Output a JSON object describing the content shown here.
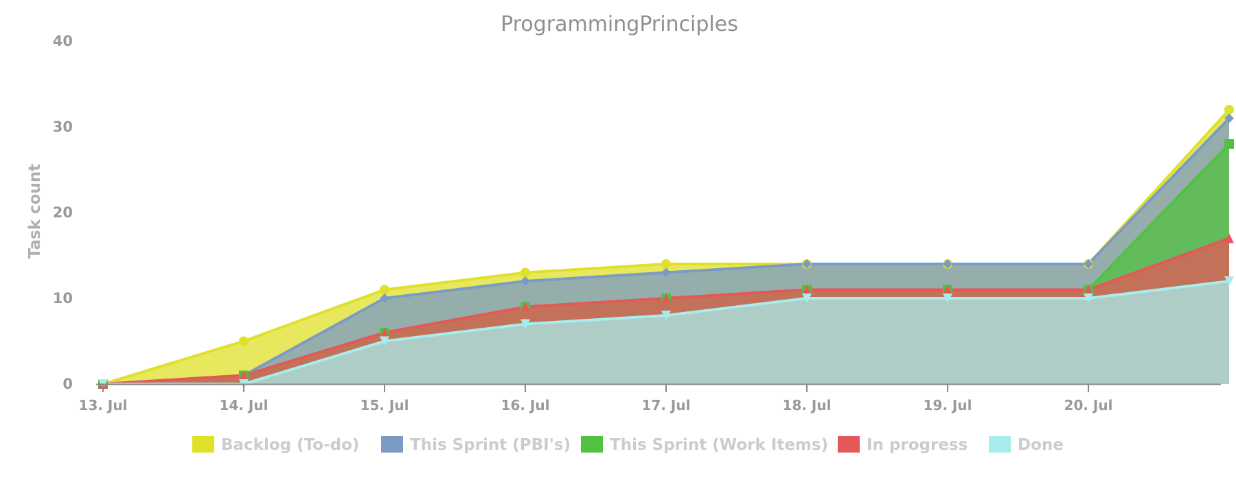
{
  "chart_data": {
    "type": "area",
    "stacked_display": "cumulative",
    "title": "ProgrammingPrinciples",
    "xlabel": "",
    "ylabel": "Task count",
    "ylim": [
      0,
      40
    ],
    "yticks": [
      "0",
      "10",
      "20",
      "30",
      "40"
    ],
    "categories": [
      "13. Jul",
      "14. Jul",
      "15. Jul",
      "16. Jul",
      "17. Jul",
      "18. Jul",
      "19. Jul",
      "20. Jul",
      ""
    ],
    "series": [
      {
        "name": "Backlog (To-do)",
        "color": "#e0e02a",
        "marker": "circle",
        "values": [
          0,
          5,
          11,
          13,
          14,
          14,
          14,
          14,
          32
        ]
      },
      {
        "name": "This Sprint (PBI's)",
        "color": "#7b9bc4",
        "marker": "diamond",
        "values": [
          0,
          1,
          10,
          12,
          13,
          14,
          14,
          14,
          31
        ]
      },
      {
        "name": "This Sprint (Work Items)",
        "color": "#52c040",
        "marker": "square",
        "values": [
          0,
          1,
          6,
          9,
          10,
          11,
          11,
          11,
          28
        ]
      },
      {
        "name": "In progress",
        "color": "#e45858",
        "marker": "triangle",
        "values": [
          0,
          1,
          6,
          9,
          10,
          11,
          11,
          11,
          17
        ]
      },
      {
        "name": "Done",
        "color": "#a8ecec",
        "marker": "triangle-down",
        "values": [
          0,
          0,
          5,
          7,
          8,
          10,
          10,
          10,
          12
        ]
      }
    ],
    "grid": false,
    "legend_position": "bottom"
  }
}
